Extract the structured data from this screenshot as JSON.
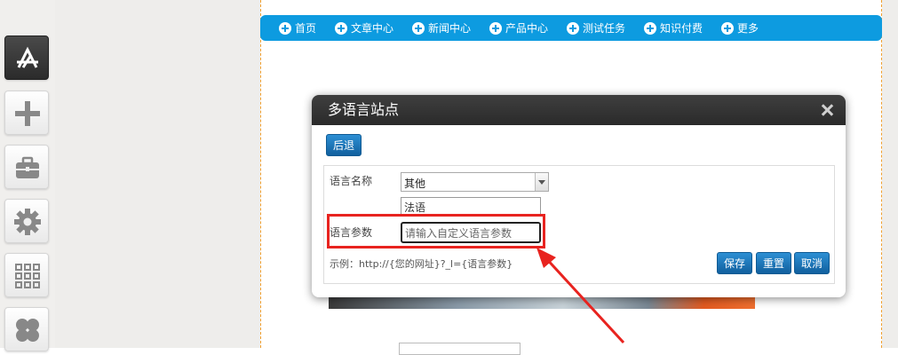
{
  "left_tools": [
    {
      "icon": "app-store-icon",
      "active": true
    },
    {
      "icon": "plus-icon",
      "active": false
    },
    {
      "icon": "toolbox-icon",
      "active": false
    },
    {
      "icon": "gear-icon",
      "active": false
    },
    {
      "icon": "grid-icon",
      "active": false
    },
    {
      "icon": "clover-icon",
      "active": false
    }
  ],
  "nav": {
    "items": [
      "首页",
      "文章中心",
      "新闻中心",
      "产品中心",
      "测试任务",
      "知识付费",
      "更多"
    ]
  },
  "dialog": {
    "title": "多语言站点",
    "back_label": "后退",
    "language_name_label": "语言名称",
    "language_select_value": "其他",
    "custom_name_value": "法语",
    "language_param_label": "语言参数",
    "language_param_placeholder": "请输入自定义语言参数",
    "example_text": "示例：http://{您的网址}?_l={语言参数}",
    "save_label": "保存",
    "reset_label": "重置",
    "cancel_label": "取消"
  },
  "colors": {
    "nav_bg": "#0d9be0",
    "button_blue": "#11609e",
    "annotation_red": "#e8231f",
    "dialog_header": "#2a2a2a"
  }
}
